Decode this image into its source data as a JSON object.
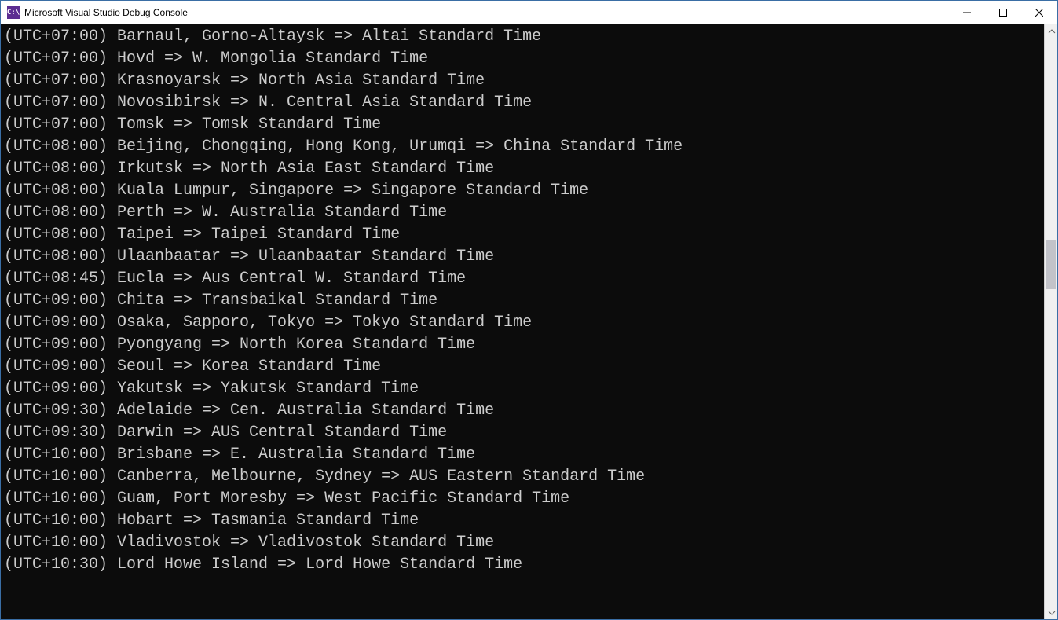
{
  "window": {
    "title": "Microsoft Visual Studio Debug Console",
    "icon_label": "C:\\"
  },
  "console": {
    "lines": [
      "(UTC+07:00) Barnaul, Gorno-Altaysk => Altai Standard Time",
      "(UTC+07:00) Hovd => W. Mongolia Standard Time",
      "(UTC+07:00) Krasnoyarsk => North Asia Standard Time",
      "(UTC+07:00) Novosibirsk => N. Central Asia Standard Time",
      "(UTC+07:00) Tomsk => Tomsk Standard Time",
      "(UTC+08:00) Beijing, Chongqing, Hong Kong, Urumqi => China Standard Time",
      "(UTC+08:00) Irkutsk => North Asia East Standard Time",
      "(UTC+08:00) Kuala Lumpur, Singapore => Singapore Standard Time",
      "(UTC+08:00) Perth => W. Australia Standard Time",
      "(UTC+08:00) Taipei => Taipei Standard Time",
      "(UTC+08:00) Ulaanbaatar => Ulaanbaatar Standard Time",
      "(UTC+08:45) Eucla => Aus Central W. Standard Time",
      "(UTC+09:00) Chita => Transbaikal Standard Time",
      "(UTC+09:00) Osaka, Sapporo, Tokyo => Tokyo Standard Time",
      "(UTC+09:00) Pyongyang => North Korea Standard Time",
      "(UTC+09:00) Seoul => Korea Standard Time",
      "(UTC+09:00) Yakutsk => Yakutsk Standard Time",
      "(UTC+09:30) Adelaide => Cen. Australia Standard Time",
      "(UTC+09:30) Darwin => AUS Central Standard Time",
      "(UTC+10:00) Brisbane => E. Australia Standard Time",
      "(UTC+10:00) Canberra, Melbourne, Sydney => AUS Eastern Standard Time",
      "(UTC+10:00) Guam, Port Moresby => West Pacific Standard Time",
      "(UTC+10:00) Hobart => Tasmania Standard Time",
      "(UTC+10:00) Vladivostok => Vladivostok Standard Time",
      "(UTC+10:30) Lord Howe Island => Lord Howe Standard Time"
    ]
  }
}
